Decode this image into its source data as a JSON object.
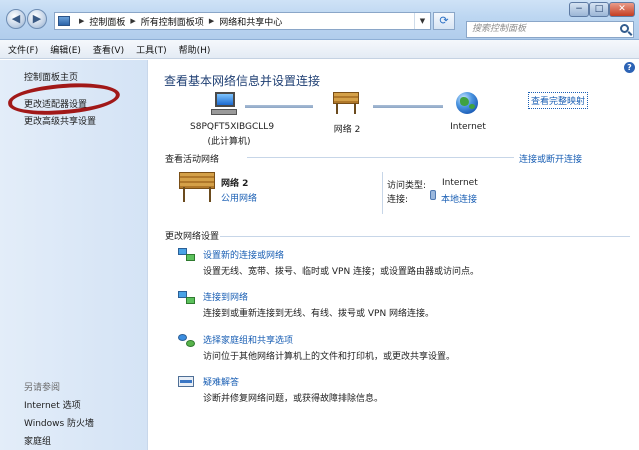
{
  "window": {
    "breadcrumbs": [
      "控制面板",
      "所有控制面板项",
      "网络和共享中心"
    ],
    "search_placeholder": "搜索控制面板",
    "buttons": {
      "minimize": "−",
      "maximize": "□",
      "close": "✕"
    }
  },
  "menu": [
    "文件(F)",
    "编辑(E)",
    "查看(V)",
    "工具(T)",
    "帮助(H)"
  ],
  "sidebar": {
    "links": [
      "控制面板主页",
      "更改适配器设置",
      "更改高级共享设置"
    ],
    "see_also_title": "另请参阅",
    "see_also": [
      "Internet 选项",
      "Windows 防火墙",
      "家庭组"
    ],
    "highlight_color": "#a11818"
  },
  "main": {
    "title": "查看基本网络信息并设置连接",
    "full_map_link": "查看完整映射",
    "map": {
      "computer_name": "S8PQFT5XIBGCLL9",
      "computer_sub": "(此计算机)",
      "network_label": "网络  2",
      "internet_label": "Internet"
    },
    "active": {
      "title": "查看活动网络",
      "connect_link": "连接或断开连接",
      "network_name": "网络  2",
      "network_type": "公用网络",
      "access_type_label": "访问类型:",
      "access_type_value": "Internet",
      "connection_label": "连接:",
      "connection_value": "本地连接"
    },
    "change": {
      "title": "更改网络设置",
      "tasks": [
        {
          "link": "设置新的连接或网络",
          "desc": "设置无线、宽带、拨号、临时或 VPN 连接；或设置路由器或访问点。"
        },
        {
          "link": "连接到网络",
          "desc": "连接到或重新连接到无线、有线、拨号或 VPN 网络连接。"
        },
        {
          "link": "选择家庭组和共享选项",
          "desc": "访问位于其他网络计算机上的文件和打印机，或更改共享设置。"
        },
        {
          "link": "疑难解答",
          "desc": "诊断并修复网络问题，或获得故障排除信息。"
        }
      ]
    }
  }
}
